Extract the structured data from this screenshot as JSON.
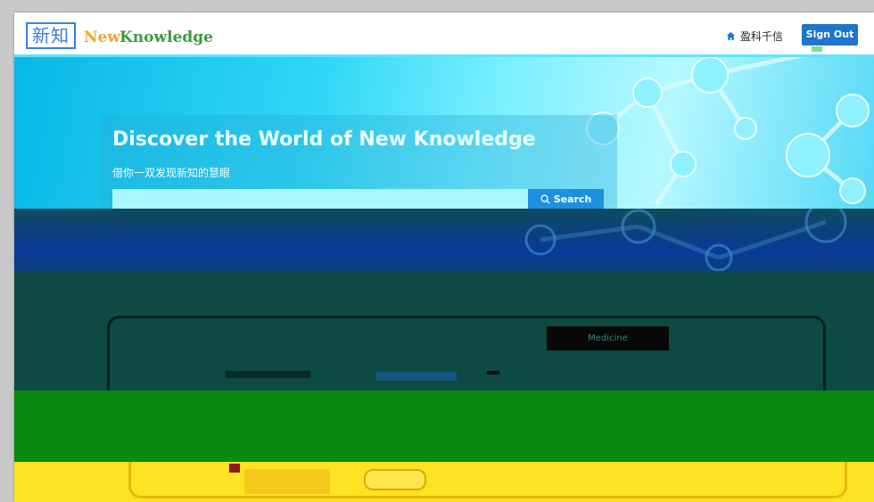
{
  "header": {
    "logo_cn": "新知",
    "logo_en_new": "New",
    "logo_en_knowledge": "Knowledge",
    "user_name": "盈科千信",
    "signout_label": "Sign Out"
  },
  "hero": {
    "title": "Discover the World of New Knowledge",
    "subtitle": "借你一双发现新知的慧眼",
    "search_placeholder": "",
    "search_button": "Search"
  },
  "tabs": {
    "active": "Medicine"
  },
  "colors": {
    "brand_blue": "#1f74cc",
    "logo_orange": "#f0a52b",
    "logo_green": "#3a9b3c",
    "hero_cyan": "#2fd6f6"
  },
  "icons": [
    "home-icon",
    "search-icon"
  ]
}
